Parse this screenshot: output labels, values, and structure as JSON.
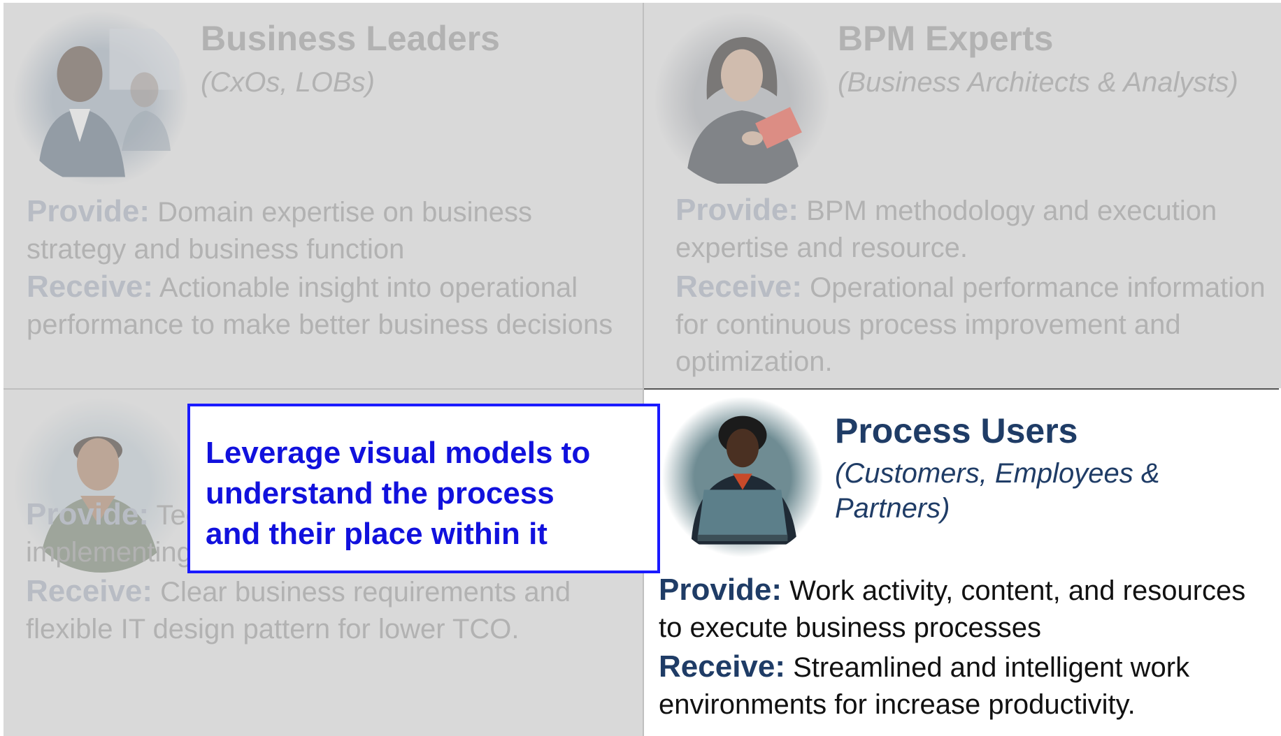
{
  "quadrants": {
    "business_leaders": {
      "title": "Business Leaders",
      "subtitle": "(CxOs, LOBs)",
      "provide_label": "Provide:",
      "provide_text": " Domain expertise on business strategy and business function",
      "receive_label": "Receive:",
      "receive_text": " Actionable insight into operational performance to make better business decisions"
    },
    "bpm_experts": {
      "title": "BPM Experts",
      "subtitle": "(Business Architects & Analysts)",
      "provide_label": "Provide:",
      "provide_text": " BPM methodology and execution expertise and resource.",
      "receive_label": "Receive:",
      "receive_text": " Operational performance information for continuous process improvement and optimization."
    },
    "it_developers": {
      "provide_label": "Provide:",
      "provide_text": " Technical expertise in resources for implementing BPM solutions.",
      "receive_label": "Receive:",
      "receive_text": " Clear business requirements and flexible IT design pattern for lower TCO."
    },
    "process_users": {
      "title": "Process Users",
      "subtitle_line1": "(Customers, Employees &",
      "subtitle_line2": "Partners)",
      "provide_label": "Provide:",
      "provide_text": " Work activity, content, and resources to execute business processes",
      "receive_label": "Receive:",
      "receive_text": " Streamlined and intelligent work environments for increase productivity."
    }
  },
  "callout": {
    "line1": "Leverage visual models to",
    "line2": "understand the process",
    "line3": "and their place within it"
  },
  "colors": {
    "muted_panel": "#d9d9d9",
    "muted_text": "#b2b2b2",
    "active_heading": "#1f3c66",
    "callout_blue": "#1111dd"
  },
  "icons": {
    "business_leaders": "business-leader-portrait",
    "bpm_experts": "bpm-expert-portrait",
    "it_developers": "it-developer-portrait",
    "process_users": "process-user-portrait"
  }
}
